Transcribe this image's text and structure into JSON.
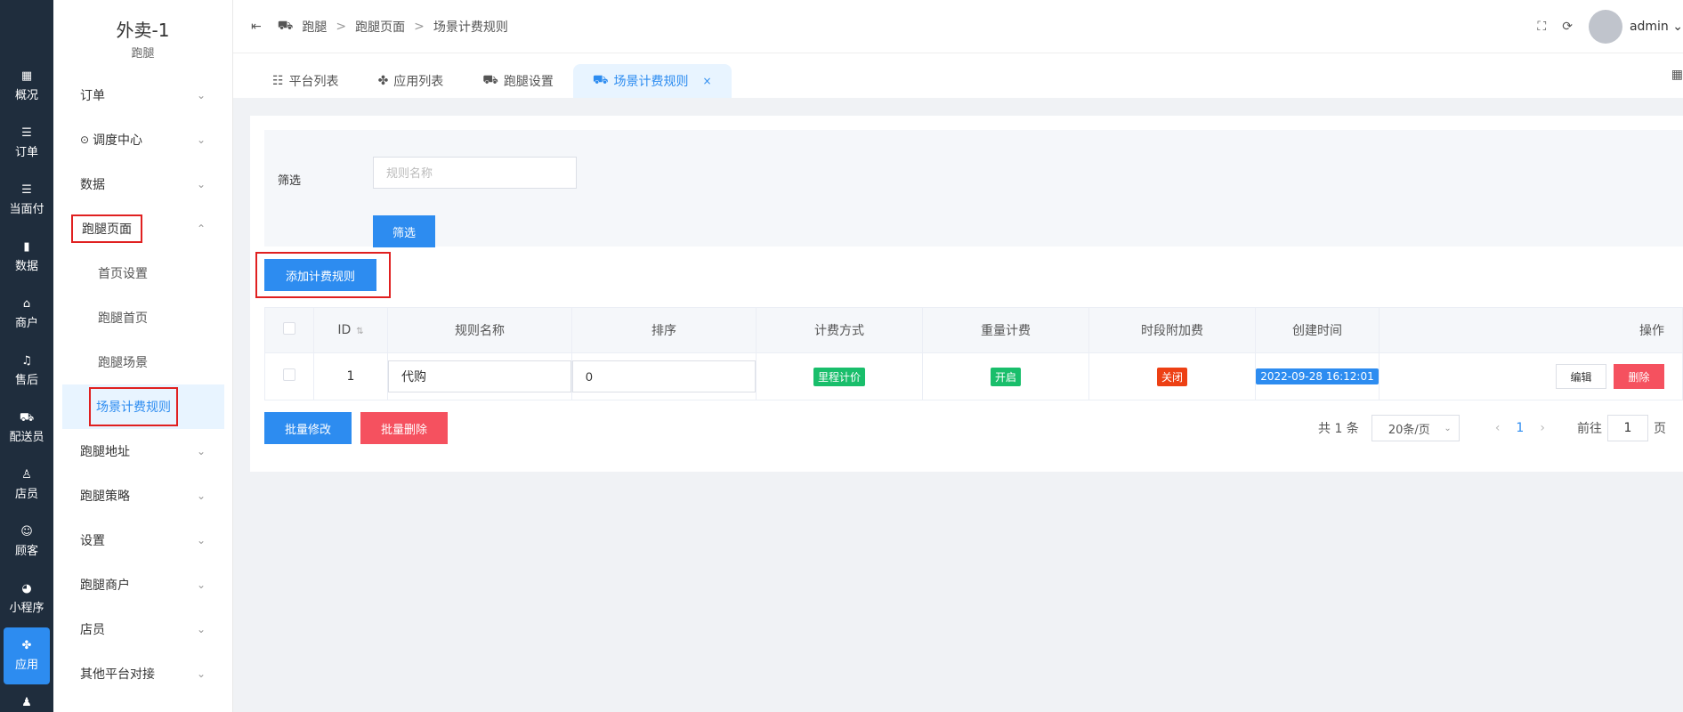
{
  "rail": {
    "items": [
      {
        "icon": "grid",
        "label": "概况"
      },
      {
        "icon": "list",
        "label": "订单"
      },
      {
        "icon": "list",
        "label": "当面付"
      },
      {
        "icon": "bar",
        "label": "数据"
      },
      {
        "icon": "store",
        "label": "商户"
      },
      {
        "icon": "headset",
        "label": "售后"
      },
      {
        "icon": "scooter",
        "label": "配送员"
      },
      {
        "icon": "users",
        "label": "店员"
      },
      {
        "icon": "user-circle",
        "label": "顾客"
      },
      {
        "icon": "wechat",
        "label": "小程序"
      },
      {
        "icon": "apps",
        "label": "应用"
      }
    ],
    "icons": {
      "grid": "▦",
      "list": "☰",
      "bar": "▮",
      "store": "⌂",
      "headset": "♫",
      "scooter": "⛟",
      "users": "♙",
      "user-circle": "☺",
      "wechat": "◕",
      "apps": "✤",
      "person": "♟"
    }
  },
  "sidebar": {
    "title": "外卖-1",
    "subtitle": "跑腿",
    "items": [
      {
        "label": "订单"
      },
      {
        "label": "调度中心"
      },
      {
        "label": "数据"
      },
      {
        "label": "跑腿页面"
      },
      {
        "label": "首页设置"
      },
      {
        "label": "跑腿首页"
      },
      {
        "label": "跑腿场景"
      },
      {
        "label": "场景计费规则"
      },
      {
        "label": "跑腿地址"
      },
      {
        "label": "跑腿策略"
      },
      {
        "label": "设置"
      },
      {
        "label": "跑腿商户"
      },
      {
        "label": "店员"
      },
      {
        "label": "其他平台对接"
      }
    ]
  },
  "header": {
    "breadcrumb": [
      "跑腿",
      "场景计费规则",
      "跑腿页面"
    ],
    "sep": ">",
    "user": "admin"
  },
  "tabs": [
    {
      "label": "平台列表"
    },
    {
      "label": "应用列表"
    },
    {
      "label": "跑腿设置"
    },
    {
      "label": "场景计费规则"
    }
  ],
  "filter": {
    "label": "筛选",
    "placeholder": "规则名称",
    "button": "筛选"
  },
  "add_button": "添加计费规则",
  "table": {
    "headers": [
      "ID",
      "规则名称",
      "排序",
      "计费方式",
      "重量计费",
      "时段附加费",
      "创建时间",
      "操作"
    ],
    "rows": [
      {
        "id": "1",
        "name": "代购",
        "sort": "0",
        "billing": "里程计价",
        "weight": "开启",
        "period": "关闭",
        "created": "2022-09-28 16:12:01",
        "edit": "编辑",
        "del": "删除"
      }
    ]
  },
  "bulk": {
    "edit": "批量修改",
    "del": "批量删除"
  },
  "pager": {
    "total": "共 1 条",
    "size": "20条/页",
    "current": "1",
    "goto": "前往",
    "goto_value": "1",
    "page": "页"
  },
  "colors": {
    "primary": "#2d8cf0",
    "danger": "#f5515f",
    "rail": "#1f2d3d",
    "annotation": "#e02020"
  }
}
